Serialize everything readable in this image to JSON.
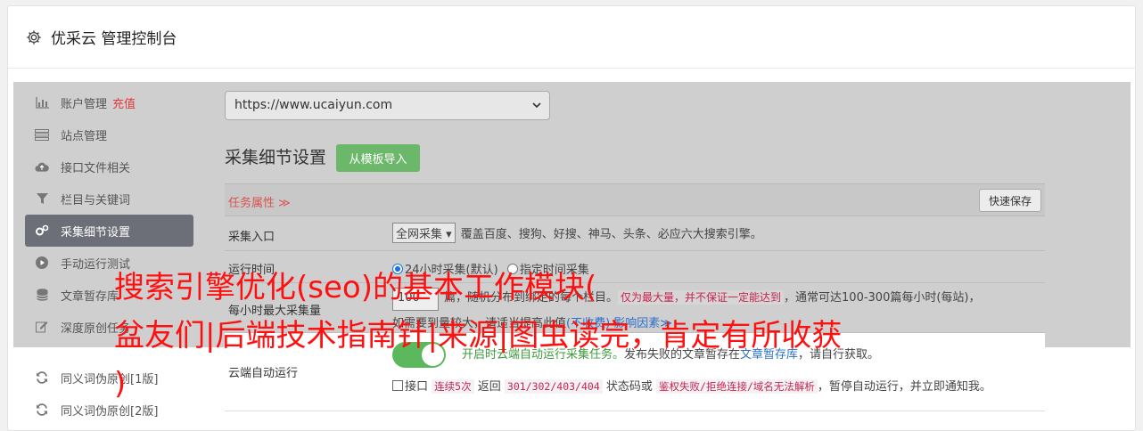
{
  "header": {
    "title": "优采云 管理控制台"
  },
  "sidebar": {
    "items": [
      {
        "label": "账户管理",
        "extra": "充值",
        "icon": "bar-chart-icon"
      },
      {
        "label": "站点管理",
        "icon": "server-icon"
      },
      {
        "label": "接口文件相关",
        "icon": "cloud-upload-icon"
      },
      {
        "label": "栏目与关键词",
        "icon": "filter-icon"
      },
      {
        "label": "采集细节设置",
        "icon": "gears-icon"
      },
      {
        "label": "手动运行测试",
        "icon": "play-circle-icon"
      },
      {
        "label": "文章暂存库",
        "icon": "database-icon"
      },
      {
        "label": "深度原创任务",
        "icon": "edit-icon"
      }
    ],
    "lower_items": [
      {
        "label": "同义词伪原创[1版]",
        "icon": "refresh-icon"
      },
      {
        "label": "同义词伪原创[2版]",
        "icon": "refresh-icon"
      }
    ]
  },
  "main": {
    "site_select": {
      "value": "https://www.ucaiyun.com"
    },
    "section_title": "采集细节设置",
    "template_button": "从模板导入",
    "attr_label": "任务属性 ≫",
    "save_button": "快速保存",
    "rows": {
      "entry": {
        "label": "采集入口",
        "select": "全网采集",
        "desc": "覆盖百度、搜狗、好搜、神马、头条、必应六大搜索引擎。"
      },
      "time": {
        "label": "运行时间",
        "opt1": "24小时采集(默认)",
        "opt2": "指定时间采集"
      },
      "hourly": {
        "label": "每小时最大采集量",
        "num": "100",
        "desc1": "篇，随机分布到绑定的每个栏目。",
        "desc2": "仅为最大量，并不保证一定能达到",
        "desc3": "，通常可达100-300篇每小时(每站)，",
        "desc4": "如需要到量较大，请适当提高此值",
        "desc5": "(不收费) 影响因素≫"
      },
      "cloud": {
        "label": "云端自动运行",
        "toggle_on": true,
        "line1_green": "开启时云端自动运行采集任务。",
        "line1_text": "发布失败的文章暂存在",
        "line1_link": "文章暂存库",
        "line1_end": "，请自行获取。",
        "line2_cb": "接口",
        "line2_code1": "连续5次",
        "line2_t1": "返回",
        "line2_code2": "301/302/403/404",
        "line2_t2": "状态码或",
        "line2_code3": "鉴权失败/拒绝连接/域名无法解析",
        "line2_t3": "，暂停自动运行，并立即通知我。"
      }
    }
  },
  "overlay": {
    "line1": "搜索引擎优化(seo)的基本工作模块(",
    "line2": "盆友们|后端技术指南针|来源|图虫读完，肯定有所收获",
    "line3": ")"
  },
  "colors": {
    "accent_green": "#5cb85c",
    "overlay_red": "#ff1010",
    "active_nav": "#6d6f78"
  }
}
